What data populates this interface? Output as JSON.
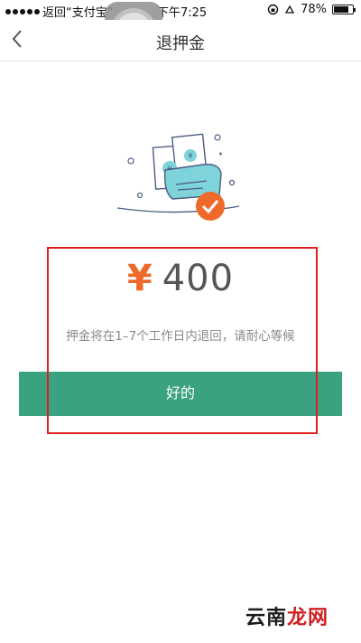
{
  "status_bar": {
    "carrier_back": "返回“支付宝”",
    "time": "下午7:25",
    "battery_percent": "78%",
    "battery_level": 0.78
  },
  "nav": {
    "back_icon": "chevron-left-icon",
    "title": "退押金"
  },
  "illustration": {
    "icon": "refund-money-check-icon",
    "colors": {
      "accent": "#ee6a2a",
      "teal": "#7fd3da",
      "line": "#4a5b82"
    }
  },
  "refund": {
    "currency_symbol": "¥",
    "amount": "400",
    "note": "押金将在1–7个工作日内退回，请耐心等候"
  },
  "actions": {
    "ok_label": "好的"
  },
  "watermark": {
    "text_a": "云南",
    "text_b": "龙网"
  },
  "colors": {
    "button": "#3aa281",
    "currency": "#ee6a2a",
    "highlight": "#e0201c"
  }
}
